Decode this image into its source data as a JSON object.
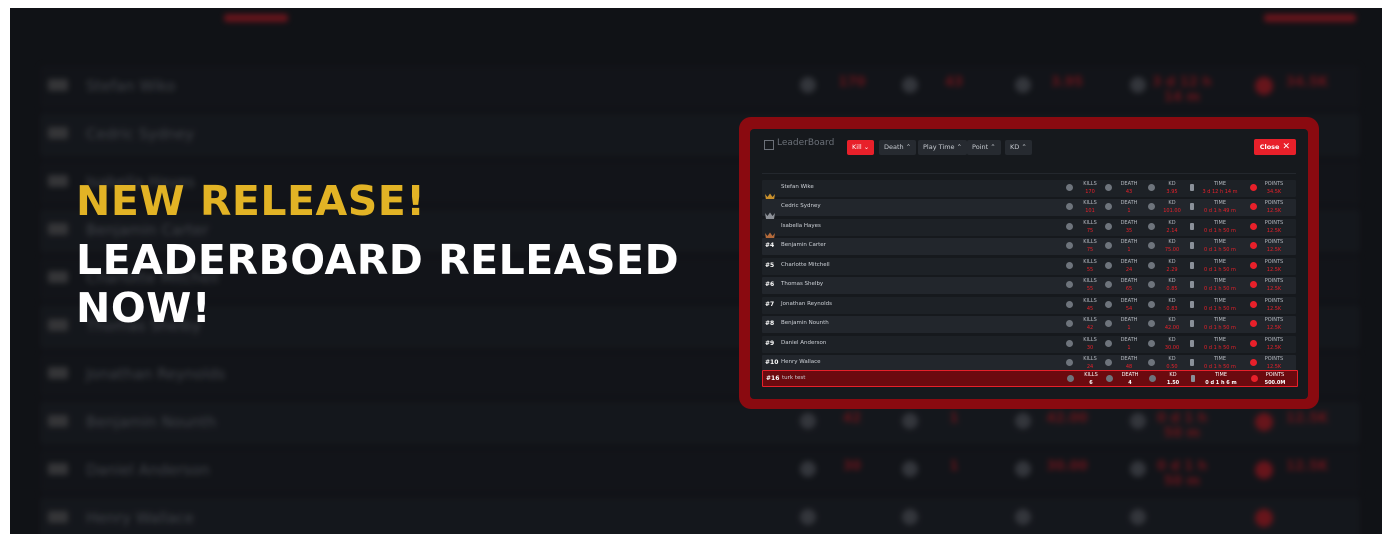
{
  "headline": {
    "line1": "NEW RELEASE!",
    "line2": "LEADERBOARD RELEASED NOW!"
  },
  "colors": {
    "accent": "#e8202a",
    "gold": "#e2b325",
    "background": "#15181c"
  },
  "background_board": {
    "rows": [
      {
        "name": "Stefan Wiko",
        "kills": "170",
        "death": "43",
        "kd": "3.95",
        "time": "3 d 12 h 14 m",
        "points": "34.5K"
      },
      {
        "name": "Cedric Sydney",
        "kills": "",
        "death": "",
        "kd": "",
        "time": "",
        "points": ""
      },
      {
        "name": "Isabella Hayes",
        "kills": "",
        "death": "",
        "kd": "",
        "time": "",
        "points": ""
      },
      {
        "name": "Benjamin Carter",
        "kills": "",
        "death": "",
        "kd": "",
        "time": "",
        "points": ""
      },
      {
        "name": "Charlotte Mitchell",
        "kills": "",
        "death": "",
        "kd": "",
        "time": "",
        "points": ""
      },
      {
        "name": "Thomas Shelby",
        "kills": "",
        "death": "",
        "kd": "",
        "time": "",
        "points": ""
      },
      {
        "name": "Jonathan Reynolds",
        "kills": "",
        "death": "",
        "kd": "",
        "time": "",
        "points": ""
      },
      {
        "name": "Benjamin Nounth",
        "kills": "42",
        "death": "1",
        "kd": "42.00",
        "time": "0 d 1 h 50 m",
        "points": "12.5K"
      },
      {
        "name": "Daniel Anderson",
        "kills": "30",
        "death": "1",
        "kd": "30.00",
        "time": "0 d 1 h 50 m",
        "points": "12.5K"
      },
      {
        "name": "Henry Wallace",
        "kills": "",
        "death": "",
        "kd": "",
        "time": "",
        "points": ""
      }
    ]
  },
  "modal": {
    "title": "LeaderBoard",
    "tabs": [
      {
        "label": "Kill ⌄",
        "active": true
      },
      {
        "label": "Death ⌃",
        "active": false
      },
      {
        "label": "Play Time ⌃",
        "active": false
      },
      {
        "label": "Point ⌃",
        "active": false
      },
      {
        "label": "KD ⌃",
        "active": false
      }
    ],
    "close_label": "Close",
    "stat_labels": {
      "kills": "KILLS",
      "death": "DEATH",
      "kd": "KD",
      "time": "TIME",
      "points": "POINTS"
    },
    "rows": [
      {
        "rank": "",
        "crown": "gold",
        "name": "Stefan Wike",
        "kills": "170",
        "death": "43",
        "kd": "3.95",
        "time": "3 d 12 h 14 m",
        "points": "34.5K"
      },
      {
        "rank": "",
        "crown": "silver",
        "name": "Cedric Sydney",
        "kills": "101",
        "death": "1",
        "kd": "101.00",
        "time": "0 d 1 h 49 m",
        "points": "12.5K"
      },
      {
        "rank": "",
        "crown": "bronze",
        "name": "Isabella Hayes",
        "kills": "75",
        "death": "35",
        "kd": "2.14",
        "time": "0 d 1 h 50 m",
        "points": "12.5K"
      },
      {
        "rank": "#4",
        "crown": "",
        "name": "Benjamin Carter",
        "kills": "75",
        "death": "1",
        "kd": "75.00",
        "time": "0 d 1 h 50 m",
        "points": "12.5K"
      },
      {
        "rank": "#5",
        "crown": "",
        "name": "Charlotte Mitchell",
        "kills": "55",
        "death": "24",
        "kd": "2.29",
        "time": "0 d 1 h 50 m",
        "points": "12.5K"
      },
      {
        "rank": "#6",
        "crown": "",
        "name": "Thomas Shelby",
        "kills": "55",
        "death": "65",
        "kd": "0.85",
        "time": "0 d 1 h 50 m",
        "points": "12.5K"
      },
      {
        "rank": "#7",
        "crown": "",
        "name": "Jonathan Reynolds",
        "kills": "45",
        "death": "54",
        "kd": "0.83",
        "time": "0 d 1 h 50 m",
        "points": "12.5K"
      },
      {
        "rank": "#8",
        "crown": "",
        "name": "Benjamin Nounth",
        "kills": "42",
        "death": "1",
        "kd": "42.00",
        "time": "0 d 1 h 50 m",
        "points": "12.5K"
      },
      {
        "rank": "#9",
        "crown": "",
        "name": "Daniel Anderson",
        "kills": "30",
        "death": "1",
        "kd": "30.00",
        "time": "0 d 1 h 50 m",
        "points": "12.5K"
      },
      {
        "rank": "#10",
        "crown": "",
        "name": "Henry Wallace",
        "kills": "24",
        "death": "48",
        "kd": "0.50",
        "time": "0 d 1 h 50 m",
        "points": "12.5K"
      }
    ],
    "current_user": {
      "rank": "#16",
      "name": "turk test",
      "kills": "6",
      "death": "4",
      "kd": "1.50",
      "time": "0 d 1 h 6 m",
      "points": "500.0M"
    }
  }
}
